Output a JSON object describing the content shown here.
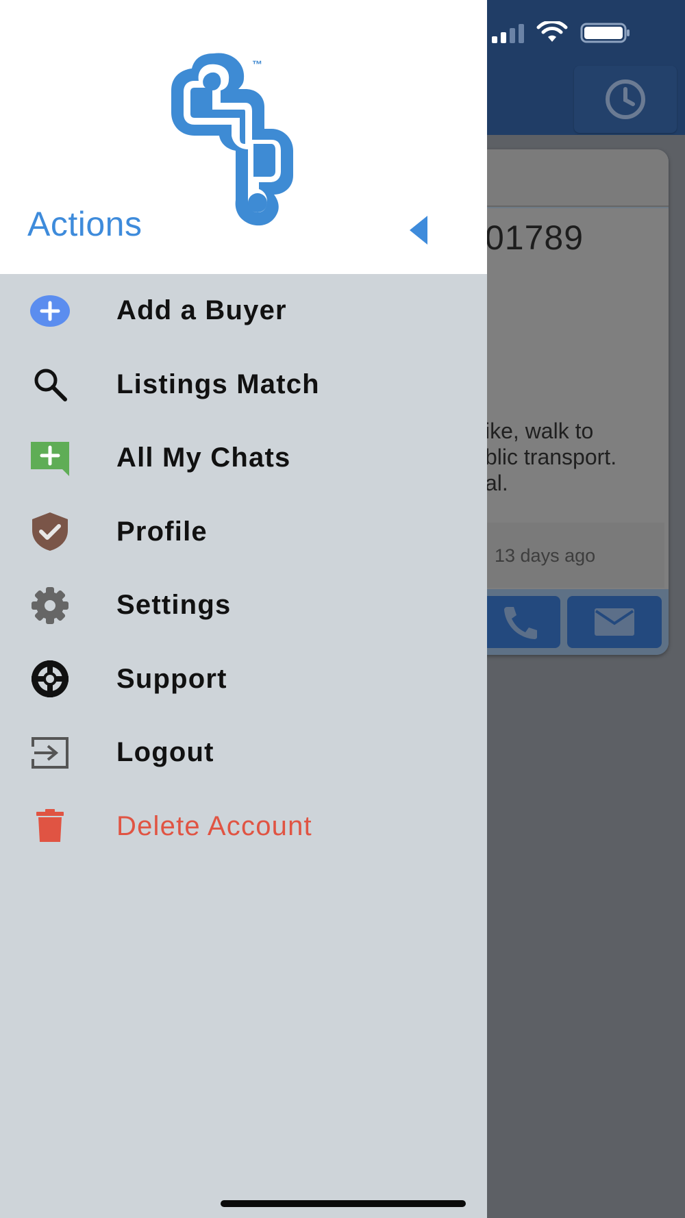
{
  "background": {
    "listing_number": "01789",
    "description": "ike, walk to\nblic transport.\nal.",
    "posted": "13 days ago",
    "icons": {
      "history": "clock-icon",
      "call": "phone-icon",
      "email": "envelope-icon"
    }
  },
  "status_bar": {
    "icons": [
      "signal-icon",
      "wifi-icon",
      "battery-icon"
    ]
  },
  "drawer": {
    "title": "Actions",
    "trademark": "™",
    "collapse_icon": "triangle-left-icon",
    "items": [
      {
        "label": "Add a Buyer",
        "icon": "plus-circle-icon",
        "color": "#5b8def"
      },
      {
        "label": "Listings Match",
        "icon": "search-icon",
        "color": "#111111"
      },
      {
        "label": "All My Chats",
        "icon": "chat-plus-icon",
        "color": "#5fad56"
      },
      {
        "label": "Profile",
        "icon": "shield-check-icon",
        "color": "#7a5548"
      },
      {
        "label": "Settings",
        "icon": "gear-icon",
        "color": "#666666"
      },
      {
        "label": "Support",
        "icon": "lifebuoy-icon",
        "color": "#111111"
      },
      {
        "label": "Logout",
        "icon": "logout-icon",
        "color": "#555555"
      },
      {
        "label": "Delete Account",
        "icon": "trash-icon",
        "color": "#e05443"
      }
    ]
  },
  "colors": {
    "accent": "#3e8bdb",
    "header": "#203d66",
    "drawer_bg": "#ced4d9",
    "danger": "#e05443"
  }
}
